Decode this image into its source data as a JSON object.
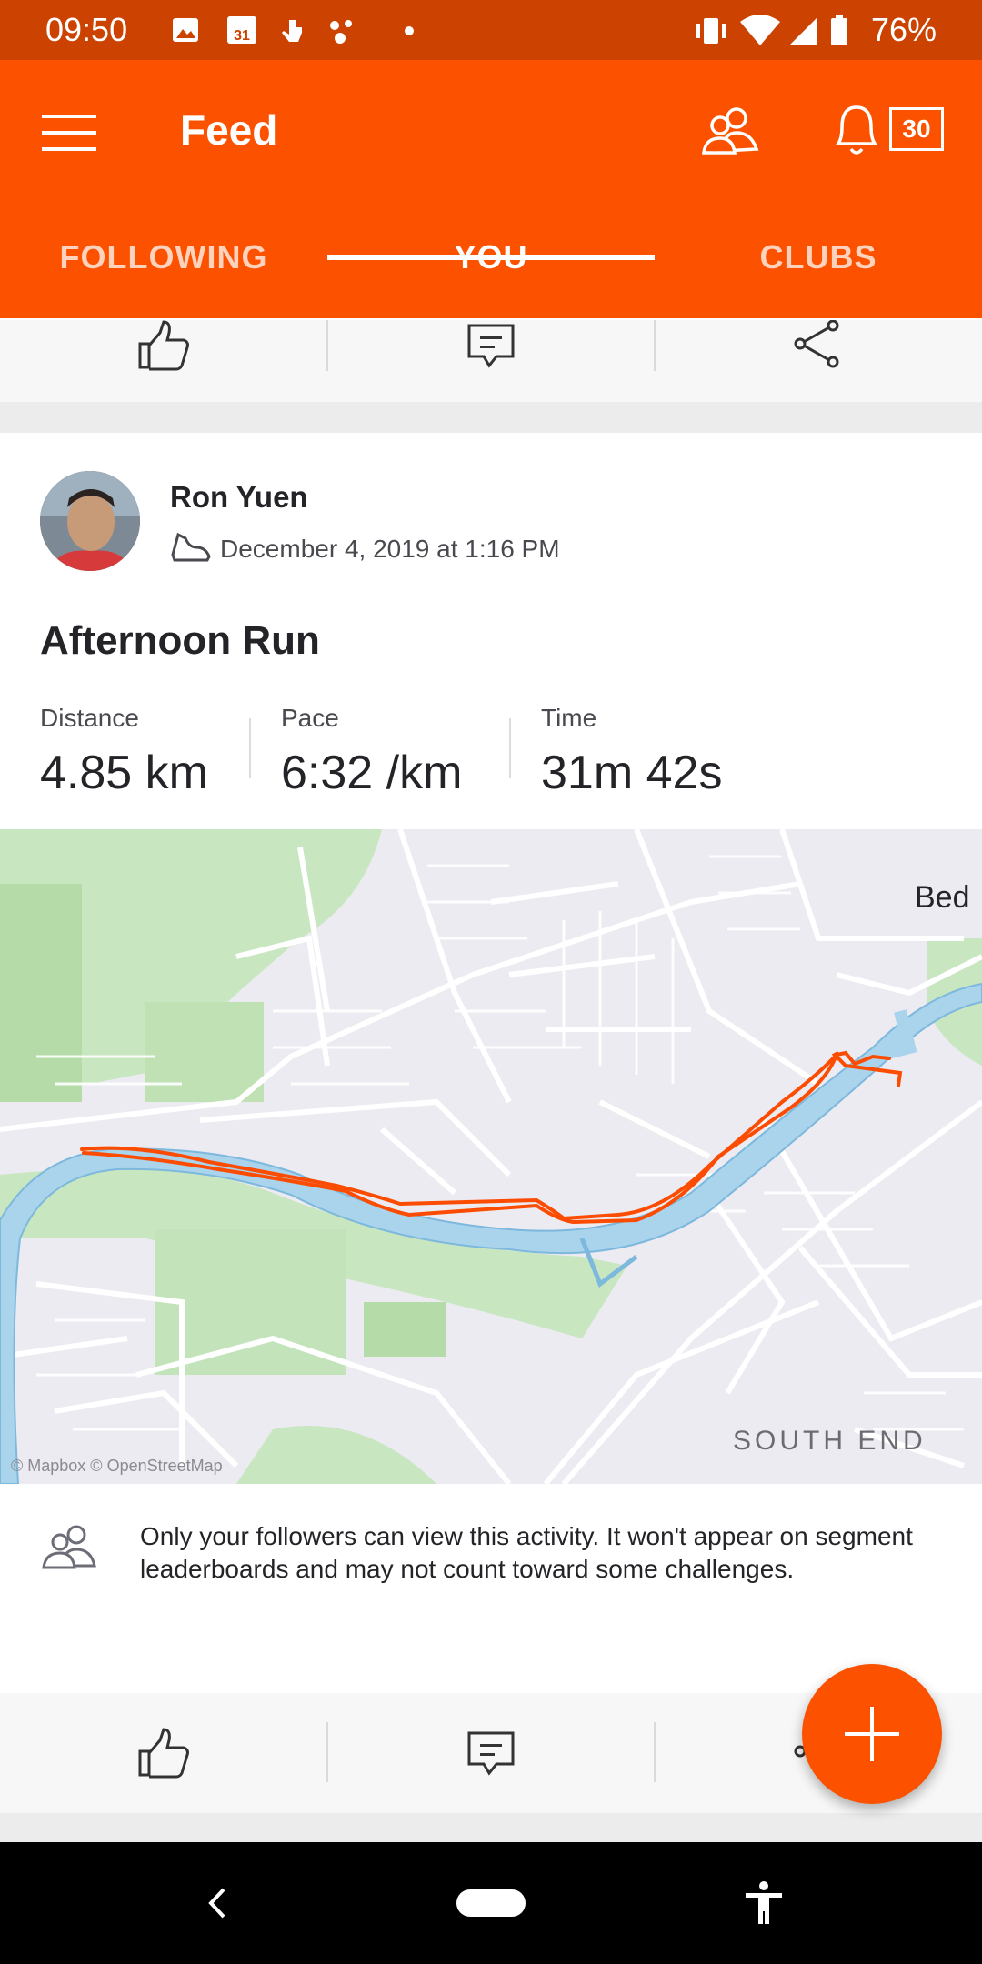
{
  "status_bar": {
    "time": "09:50",
    "calendar_day": "31",
    "battery": "76%"
  },
  "app_bar": {
    "title": "Feed",
    "notification_count": "30"
  },
  "tabs": [
    {
      "label": "FOLLOWING",
      "active": false
    },
    {
      "label": "YOU",
      "active": true
    },
    {
      "label": "CLUBS",
      "active": false
    }
  ],
  "activity": {
    "athlete_name": "Ron Yuen",
    "date": "December 4, 2019 at 1:16 PM",
    "title": "Afternoon Run",
    "stats": [
      {
        "label": "Distance",
        "value": "4.85 km"
      },
      {
        "label": "Pace",
        "value": "6:32 /km"
      },
      {
        "label": "Time",
        "value": "31m 42s"
      }
    ],
    "map": {
      "place_label_1": "Bed",
      "place_label_2": "SOUTH END",
      "attribution": "© Mapbox © OpenStreetMap"
    },
    "privacy_notice": "Only your followers can view this activity. It won't appear on segment leaderboards and may not count toward some challenges."
  },
  "icons": {
    "menu": "menu-icon",
    "friends": "friends-icon",
    "notifications": "bell-icon",
    "kudos": "thumbs-up-icon",
    "comment": "comment-icon",
    "share": "share-icon",
    "activity_type": "shoe-icon",
    "fab": "plus-icon"
  },
  "colors": {
    "brand": "#fc5200",
    "status_bar": "#cc4200",
    "route": "#fc4c02",
    "water": "#aad3ec",
    "park": "#c8e6c0"
  }
}
